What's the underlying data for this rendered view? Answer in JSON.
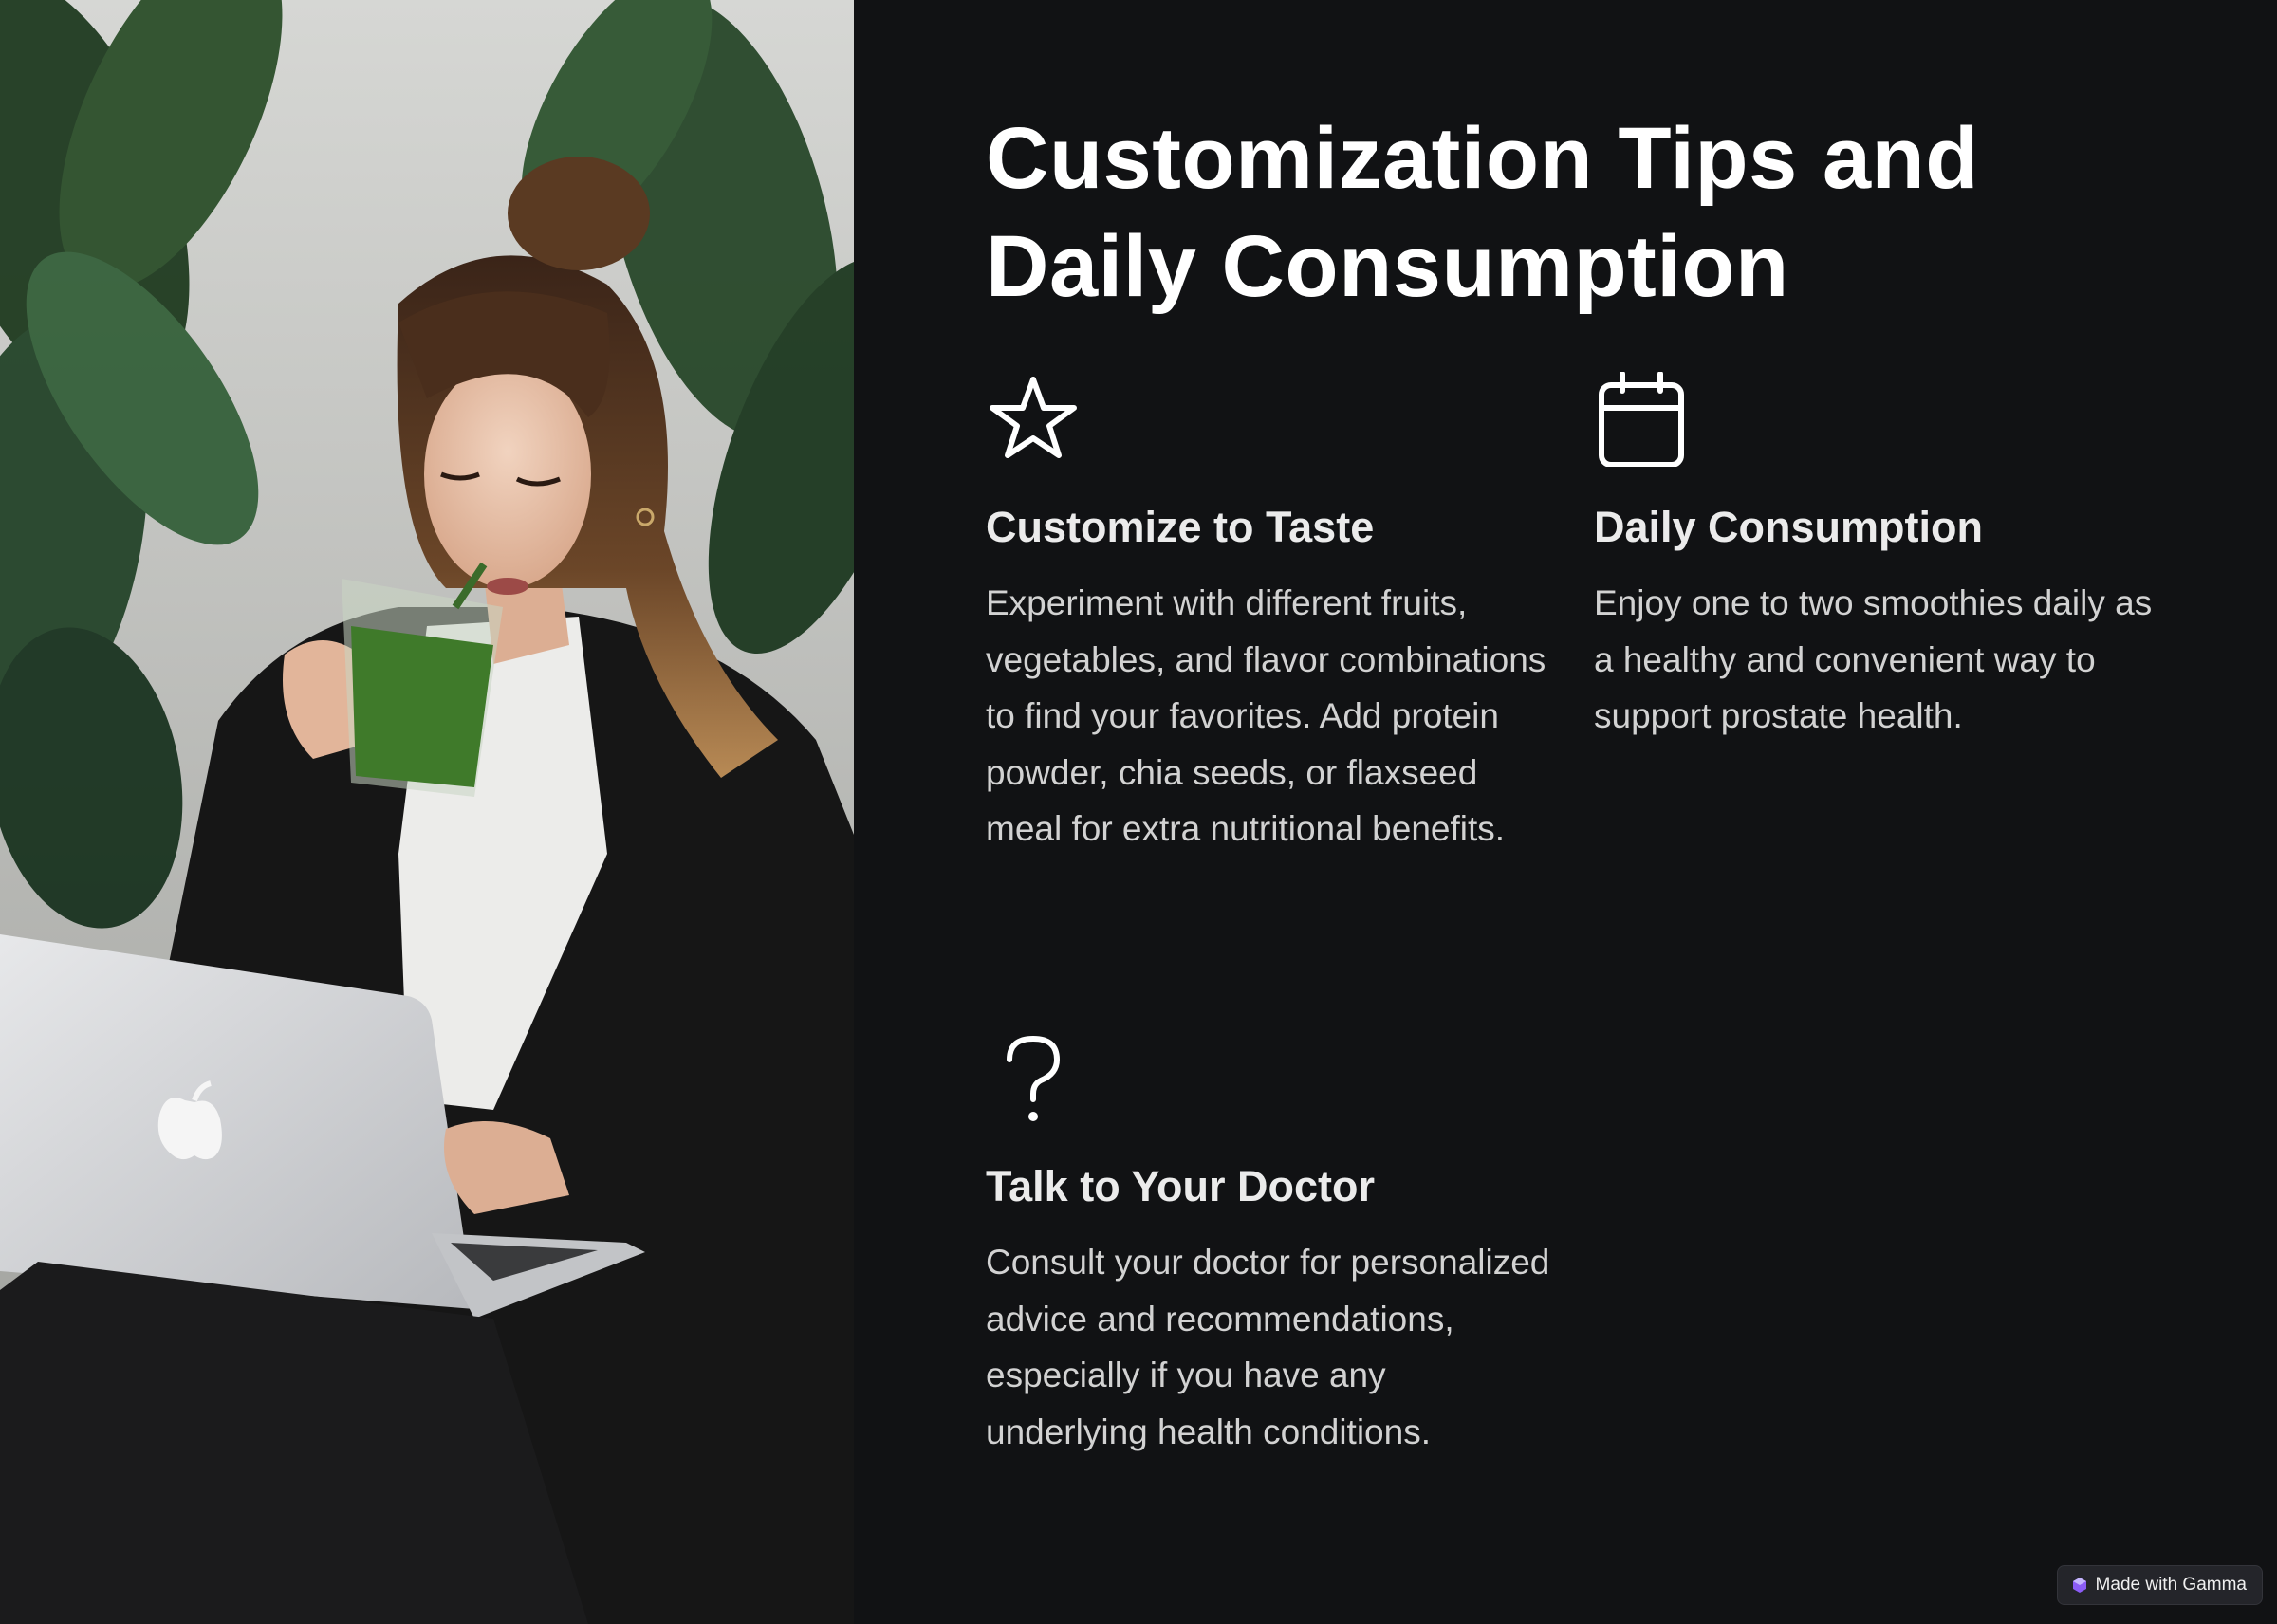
{
  "photo": {
    "alt": "Woman in black blazer sipping a green smoothie while using a laptop"
  },
  "title": "Customization Tips and Daily Consumption",
  "cards": [
    {
      "icon": "star-icon",
      "heading": "Customize to Taste",
      "body": "Experiment with different fruits, vegetables, and flavor combinations to find your favorites. Add protein powder, chia seeds, or flaxseed meal for extra nutritional benefits."
    },
    {
      "icon": "calendar-icon",
      "heading": "Daily Consumption",
      "body": "Enjoy one to two smoothies daily as a healthy and convenient way to support prostate health."
    },
    {
      "icon": "question-mark-icon",
      "heading": "Talk to Your Doctor",
      "body": "Consult your doctor for personalized advice and recommendations, especially if you have any underlying health conditions."
    }
  ],
  "badge": {
    "label": "Made with Gamma"
  },
  "colors": {
    "background": "#111214",
    "title": "#ffffff",
    "heading": "#ebebeb",
    "body": "#d2d2d2",
    "badge_bg": "#24252a",
    "badge_logo": "#8b5cf6"
  }
}
